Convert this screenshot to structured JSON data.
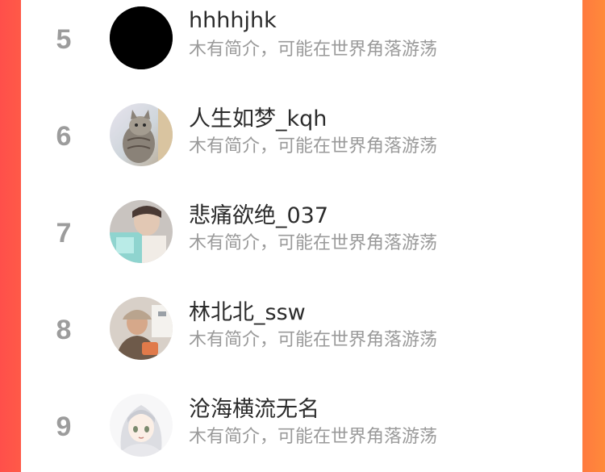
{
  "users": [
    {
      "rank": "5",
      "name": "hhhhjhk",
      "bio": "木有简介，可能在世界角落游荡",
      "avatar_icon": "black-circle-avatar"
    },
    {
      "rank": "6",
      "name": "人生如梦_kqh",
      "bio": "木有简介，可能在世界角落游荡",
      "avatar_icon": "cat-avatar"
    },
    {
      "rank": "7",
      "name": "悲痛欲绝_037",
      "bio": "木有简介，可能在世界角落游荡",
      "avatar_icon": "person-teal-avatar"
    },
    {
      "rank": "8",
      "name": "林北北_ssw",
      "bio": "木有简介，可能在世界角落游荡",
      "avatar_icon": "person-cap-avatar"
    },
    {
      "rank": "9",
      "name": "沧海横流无名",
      "bio": "木有简介，可能在世界角落游荡",
      "avatar_icon": "anime-girl-avatar"
    }
  ],
  "colors": {
    "left_edge": "#ff4f4a",
    "right_edge": "#ff7a3f",
    "rank_text": "#9c9c9c",
    "name_text": "#2b2b2b",
    "bio_text": "#9a9a9a"
  }
}
